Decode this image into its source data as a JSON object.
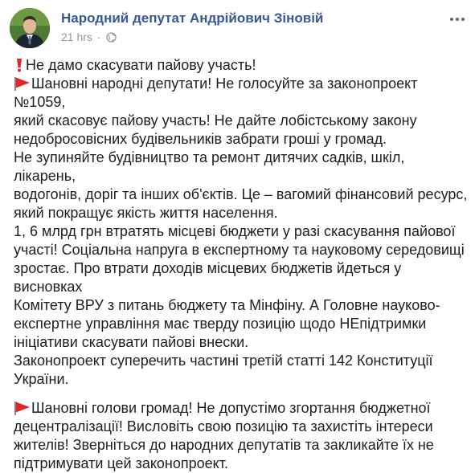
{
  "post": {
    "author": "Народний депутат Андрійович Зіновій",
    "time": "21 hrs",
    "separator": "·",
    "icons": {
      "avatar": "avatar-photo",
      "privacy": "globe-icon",
      "menu": "more-options-icon",
      "exclamation": "red-exclamation-icon",
      "flag": "red-triangular-flag-icon"
    },
    "colors": {
      "author": "#365899",
      "meta": "#90949c",
      "text": "#1c1e21",
      "flag": "#e0282b"
    },
    "lines": {
      "l1": "Не дамо скасувати пайову участь!",
      "l2": "Шановні народні депутати! Не голосуйте за законопроект №1059,",
      "l3": "який скасовує пайову участь! Не дайте лобістському закону",
      "l4": "недобросовісних будівельників забрати гроші у громад.",
      "l5": "Не зупиняйте будівництво та ремонт дитячих садків, шкіл, лікарень,",
      "l6": "водогонів, доріг та інших об'єктів. Це – вагомий фінансовий ресурс,",
      "l7": "який покращує якість життя населення.",
      "l8": "1, 6 млрд грн втратять місцеві бюджети у разі скасування пайової",
      "l9": "участі! Соціальна напруга в експертному та науковому середовищі",
      "l10": "зростає. Про втрати доходів місцевих бюджетів йдеться у висновках",
      "l11": "Комітету ВРУ з питань бюджету та Мінфіну. А Головне науково-",
      "l12": "експертне управління має тверду позицію щодо НЕпідтримки",
      "l13": "ініціативи скасувати пайові внески.",
      "l14": "Законопроект суперечить частині третій статті 142 Конституції",
      "l15": "України.",
      "l16": "Шановні голови громад! Не допустімо згортання бюджетної",
      "l17": "децентралізації! Висловіть свою позицію та захистіть інтереси",
      "l18": "жителів! Зверніться до народних депутатів та закликайте їх не",
      "l19": "підтримувати цей законопроект."
    }
  }
}
